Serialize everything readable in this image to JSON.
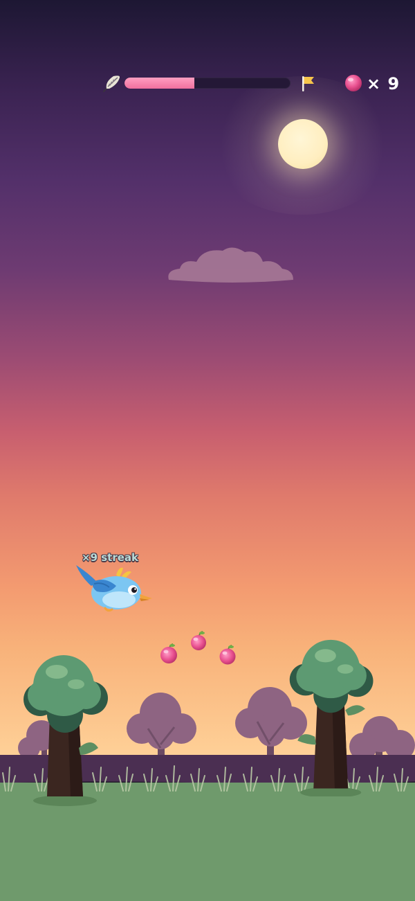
{
  "hud": {
    "feather_icon": "feather-icon",
    "progress_fraction": 0.42,
    "progress_colors": {
      "fill": "#f0709e",
      "track": "#241836"
    },
    "flag_icon": "flag-icon",
    "berry_icon": "berry-icon",
    "berry_count": "× 9"
  },
  "player": {
    "streak_label": "×9 streak",
    "character_icon": "blue-bird-icon"
  },
  "scene": {
    "moon_icon": "moon-icon",
    "cloud_icon": "cloud-icon",
    "berry_pickups": 3,
    "colors": {
      "sky_top": "#1d1733",
      "sky_bottom": "#ffe7b0",
      "ground": "#6f9a6c",
      "berry": "#e8508f"
    }
  }
}
